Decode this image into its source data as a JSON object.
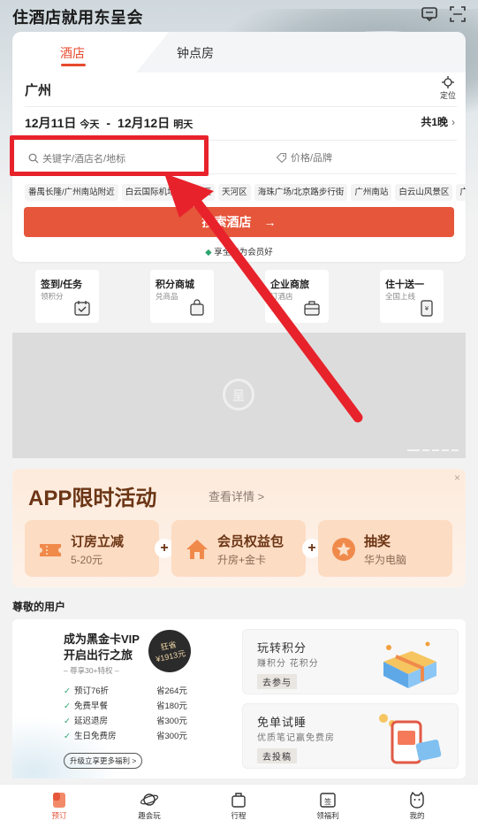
{
  "app": {
    "title": "住酒店就用东呈会"
  },
  "header": {
    "message_icon": "message-icon",
    "scan_icon": "scan-icon"
  },
  "booking": {
    "tabs": [
      {
        "label": "酒店",
        "active": true
      },
      {
        "label": "钟点房",
        "active": false
      }
    ],
    "city": "广州",
    "locate_label": "定位",
    "checkin_date": "12月11日",
    "checkin_day": "今天",
    "separator": "-",
    "checkout_date": "12月12日",
    "checkout_day": "明天",
    "nights": "共1晚",
    "search_placeholder": "关键字/酒店名/地标",
    "price_brand": "价格/品牌",
    "chips": [
      "番禺长隆/广州南站附近",
      "白云国际机场",
      "白云区",
      "天河区",
      "海珠广场/北京路步行街",
      "广州南站",
      "白云山风景区",
      "广"
    ],
    "search_button": "搜索酒店",
    "member_text": "享全意为会员好"
  },
  "quick_entries": [
    {
      "title": "签到/任务",
      "sub": "领积分",
      "icon": "calendar-check-icon"
    },
    {
      "title": "积分商城",
      "sub": "兑商品",
      "icon": "shopping-bag-icon"
    },
    {
      "title": "企业商旅",
      "sub": "订酒店",
      "icon": "briefcase-icon"
    },
    {
      "title": "住十送一",
      "sub": "全国上线",
      "icon": "phone-yen-icon"
    }
  ],
  "banner": {
    "logo_text": "呈"
  },
  "promo": {
    "title": "APP限时活动",
    "more": "查看详情 >",
    "close": "×",
    "items": [
      {
        "title": "订房立减",
        "sub": "5-20元",
        "icon": "ticket-icon"
      },
      {
        "title": "会员权益包",
        "sub": "升房+金卡",
        "icon": "house-icon"
      },
      {
        "title": "抽奖",
        "sub": "华为电脑",
        "icon": "star-icon"
      }
    ],
    "plus": "+"
  },
  "respect_title": "尊敬的用户",
  "vip": {
    "title_line1": "成为黑金卡VIP",
    "title_line2": "开启出行之旅",
    "badge_line1": "狂省",
    "badge_line2": "¥1913元",
    "sub": "– 尊享30+特权 –",
    "rows": [
      {
        "label": "预订76折",
        "save": "省264元"
      },
      {
        "label": "免费早餐",
        "save": "省180元"
      },
      {
        "label": "延迟退房",
        "save": "省300元"
      },
      {
        "label": "生日免费房",
        "save": "省300元"
      }
    ],
    "upgrade": "升级立享更多福利 >"
  },
  "side_cards": [
    {
      "title": "玩转积分",
      "sub": "赚积分 花积分",
      "button": "去参与"
    },
    {
      "title": "免单试睡",
      "sub": "优质笔记赢免费房",
      "button": "去投稿"
    }
  ],
  "tabbar": [
    {
      "label": "预订",
      "icon": "booking-icon",
      "active": true
    },
    {
      "label": "趣会玩",
      "icon": "planet-icon",
      "active": false
    },
    {
      "label": "行程",
      "icon": "luggage-icon",
      "active": false
    },
    {
      "label": "领福利",
      "icon": "gift-calendar-icon",
      "active": false
    },
    {
      "label": "我的",
      "icon": "cat-face-icon",
      "active": false
    }
  ],
  "colors": {
    "accent": "#e5563a",
    "highlight": "#e8222b",
    "member_green": "#2aa36e",
    "promo_brown": "#6b3515"
  }
}
